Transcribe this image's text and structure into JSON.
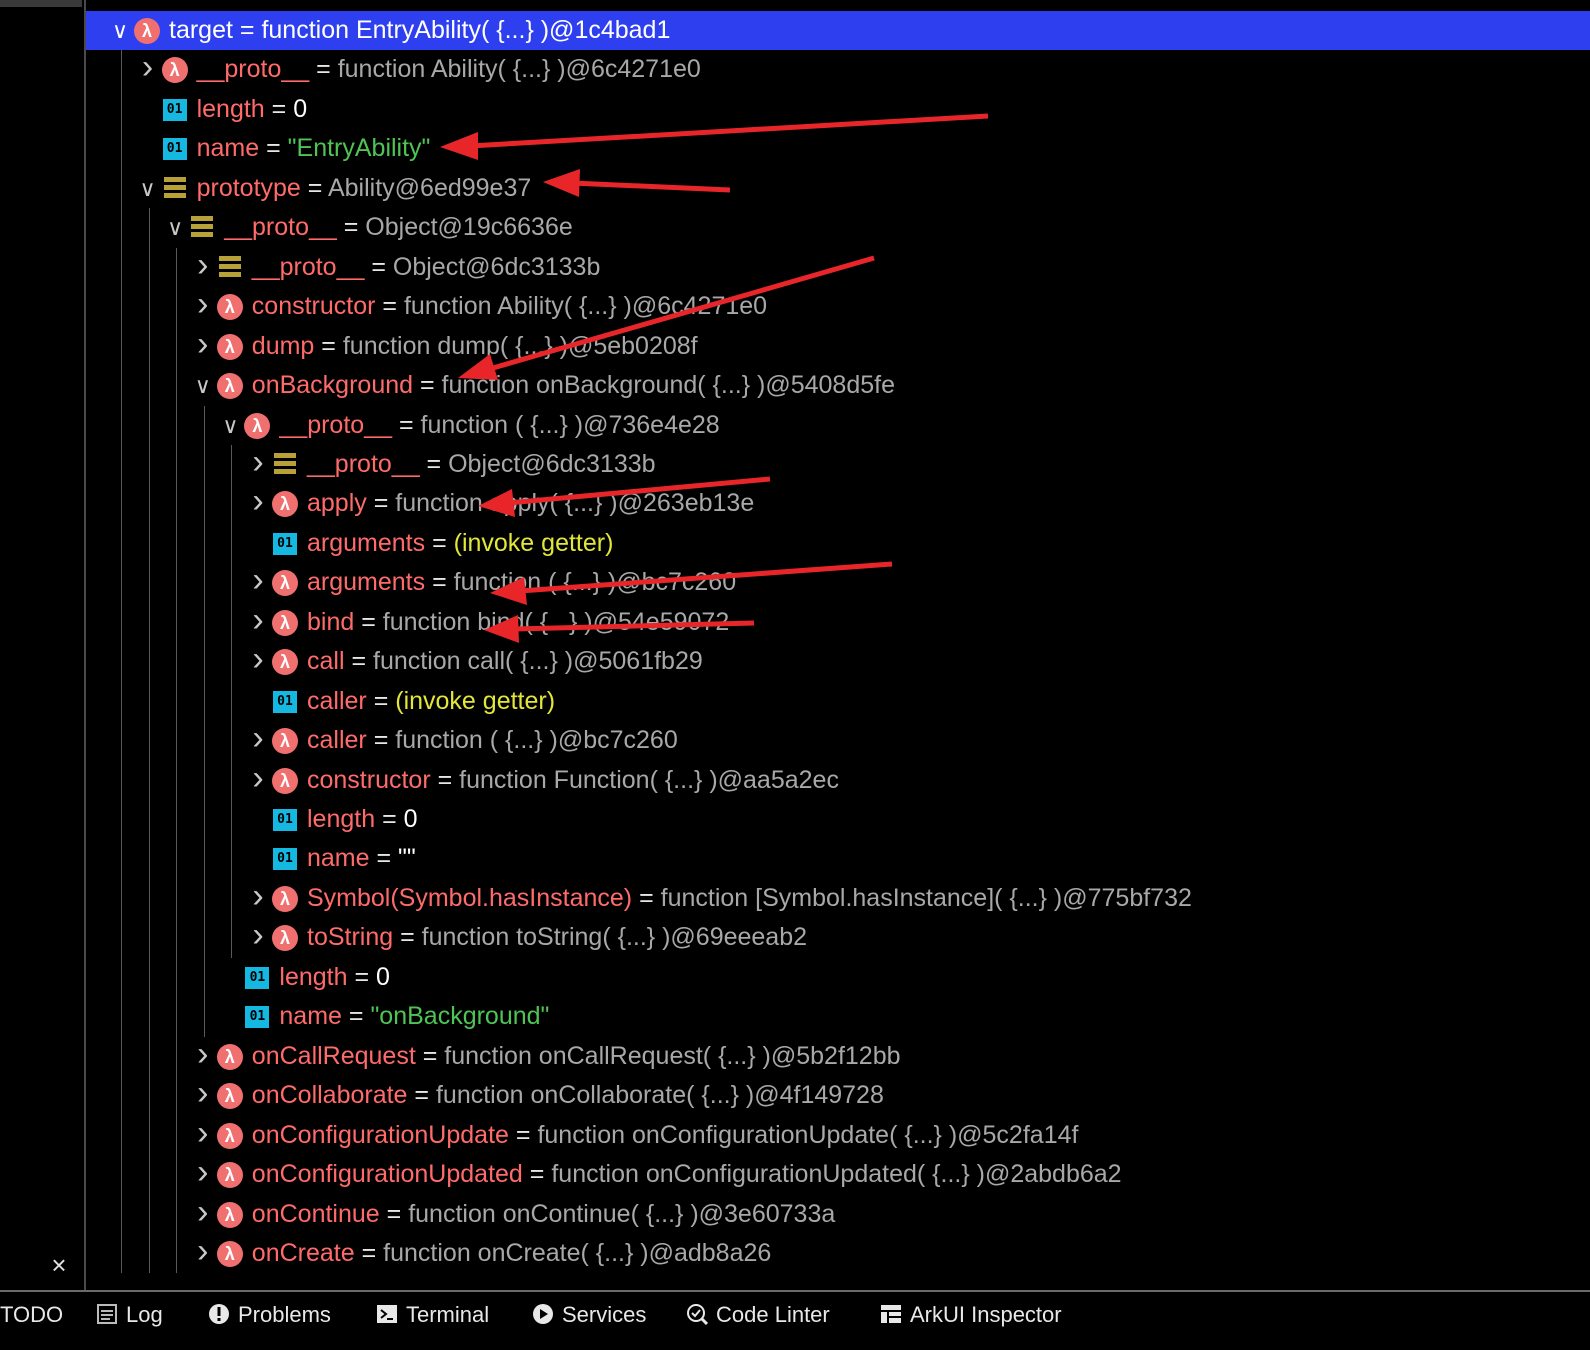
{
  "window": {
    "close_glyph": "×"
  },
  "tree": {
    "partial_top_row": "target = function EntryAbility( {...} )@1c4bad1",
    "rows": [
      {
        "depth": 0,
        "expand": "open",
        "icon": "lambda",
        "key": "target",
        "value": "function EntryAbility( {...} )@1c4bad1",
        "kind": "fn",
        "selected": true
      },
      {
        "depth": 1,
        "expand": "closed",
        "icon": "lambda",
        "key": "__proto__",
        "value": "function Ability( {...} )@6c4271e0",
        "kind": "fn"
      },
      {
        "depth": 1,
        "expand": "none",
        "icon": "number",
        "key": "length",
        "value": "0",
        "kind": "num"
      },
      {
        "depth": 1,
        "expand": "none",
        "icon": "number",
        "key": "name",
        "value": "\"EntryAbility\"",
        "kind": "str"
      },
      {
        "depth": 1,
        "expand": "open",
        "icon": "object",
        "key": "prototype",
        "value": "Ability@6ed99e37",
        "kind": "obj"
      },
      {
        "depth": 2,
        "expand": "open",
        "icon": "object",
        "key": "__proto__",
        "value": "Object@19c6636e",
        "kind": "obj"
      },
      {
        "depth": 3,
        "expand": "closed",
        "icon": "object",
        "key": "__proto__",
        "value": "Object@6dc3133b",
        "kind": "obj"
      },
      {
        "depth": 3,
        "expand": "closed",
        "icon": "lambda",
        "key": "constructor",
        "value": "function Ability( {...} )@6c4271e0",
        "kind": "fn"
      },
      {
        "depth": 3,
        "expand": "closed",
        "icon": "lambda",
        "key": "dump",
        "value": "function dump( {...} )@5eb0208f",
        "kind": "fn"
      },
      {
        "depth": 3,
        "expand": "open",
        "icon": "lambda",
        "key": "onBackground",
        "value": "function onBackground( {...} )@5408d5fe",
        "kind": "fn"
      },
      {
        "depth": 4,
        "expand": "open",
        "icon": "lambda",
        "key": "__proto__",
        "value": "function ( {...} )@736e4e28",
        "kind": "fn"
      },
      {
        "depth": 5,
        "expand": "closed",
        "icon": "object",
        "key": "__proto__",
        "value": "Object@6dc3133b",
        "kind": "obj"
      },
      {
        "depth": 5,
        "expand": "closed",
        "icon": "lambda",
        "key": "apply",
        "value": "function apply( {...} )@263eb13e",
        "kind": "fn"
      },
      {
        "depth": 5,
        "expand": "none",
        "icon": "number",
        "key": "arguments",
        "value": "(invoke getter)",
        "kind": "getter"
      },
      {
        "depth": 5,
        "expand": "closed",
        "icon": "lambda",
        "key": "arguments",
        "value": "function ( {...} )@bc7c260",
        "kind": "fn"
      },
      {
        "depth": 5,
        "expand": "closed",
        "icon": "lambda",
        "key": "bind",
        "value": "function bind( {...} )@54e59072",
        "kind": "fn"
      },
      {
        "depth": 5,
        "expand": "closed",
        "icon": "lambda",
        "key": "call",
        "value": "function call( {...} )@5061fb29",
        "kind": "fn"
      },
      {
        "depth": 5,
        "expand": "none",
        "icon": "number",
        "key": "caller",
        "value": "(invoke getter)",
        "kind": "getter"
      },
      {
        "depth": 5,
        "expand": "closed",
        "icon": "lambda",
        "key": "caller",
        "value": "function ( {...} )@bc7c260",
        "kind": "fn"
      },
      {
        "depth": 5,
        "expand": "closed",
        "icon": "lambda",
        "key": "constructor",
        "value": "function Function( {...} )@aa5a2ec",
        "kind": "fn"
      },
      {
        "depth": 5,
        "expand": "none",
        "icon": "number",
        "key": "length",
        "value": "0",
        "kind": "num"
      },
      {
        "depth": 5,
        "expand": "none",
        "icon": "number",
        "key": "name",
        "value": "\"\"",
        "kind": "str-plain"
      },
      {
        "depth": 5,
        "expand": "closed",
        "icon": "lambda",
        "key": "Symbol(Symbol.hasInstance)",
        "value": "function [Symbol.hasInstance]( {...} )@775bf732",
        "kind": "fn"
      },
      {
        "depth": 5,
        "expand": "closed",
        "icon": "lambda",
        "key": "toString",
        "value": "function toString( {...} )@69eeeab2",
        "kind": "fn"
      },
      {
        "depth": 4,
        "expand": "none",
        "icon": "number",
        "key": "length",
        "value": "0",
        "kind": "num"
      },
      {
        "depth": 4,
        "expand": "none",
        "icon": "number",
        "key": "name",
        "value": "\"onBackground\"",
        "kind": "str"
      },
      {
        "depth": 3,
        "expand": "closed",
        "icon": "lambda",
        "key": "onCallRequest",
        "value": "function onCallRequest( {...} )@5b2f12bb",
        "kind": "fn"
      },
      {
        "depth": 3,
        "expand": "closed",
        "icon": "lambda",
        "key": "onCollaborate",
        "value": "function onCollaborate( {...} )@4f149728",
        "kind": "fn"
      },
      {
        "depth": 3,
        "expand": "closed",
        "icon": "lambda",
        "key": "onConfigurationUpdate",
        "value": "function onConfigurationUpdate( {...} )@5c2fa14f",
        "kind": "fn"
      },
      {
        "depth": 3,
        "expand": "closed",
        "icon": "lambda",
        "key": "onConfigurationUpdated",
        "value": "function onConfigurationUpdated( {...} )@2abdb6a2",
        "kind": "fn"
      },
      {
        "depth": 3,
        "expand": "closed",
        "icon": "lambda",
        "key": "onContinue",
        "value": "function onContinue( {...} )@3e60733a",
        "kind": "fn"
      },
      {
        "depth": 3,
        "expand": "closed",
        "icon": "lambda",
        "key": "onCreate",
        "value": "function onCreate( {...} )@adb8a26",
        "kind": "fn"
      }
    ]
  },
  "icons": {
    "lambda": "λ",
    "number": "01",
    "object": "object-icon"
  },
  "toolbar": {
    "items": [
      {
        "label": "TODO",
        "icon": "none"
      },
      {
        "label": "Log",
        "icon": "log-icon"
      },
      {
        "label": "Problems",
        "icon": "problems-icon"
      },
      {
        "label": "Terminal",
        "icon": "terminal-icon"
      },
      {
        "label": "Services",
        "icon": "services-icon"
      },
      {
        "label": "Code Linter",
        "icon": "code-linter-icon"
      },
      {
        "label": "ArkUI Inspector",
        "icon": "arkui-inspector-icon"
      }
    ]
  },
  "colors": {
    "selection": "#2e3ff0",
    "key": "#ff6b6b",
    "string": "#4fc455",
    "getter": "#e2e63a",
    "annotation_arrow": "#e8262a"
  }
}
